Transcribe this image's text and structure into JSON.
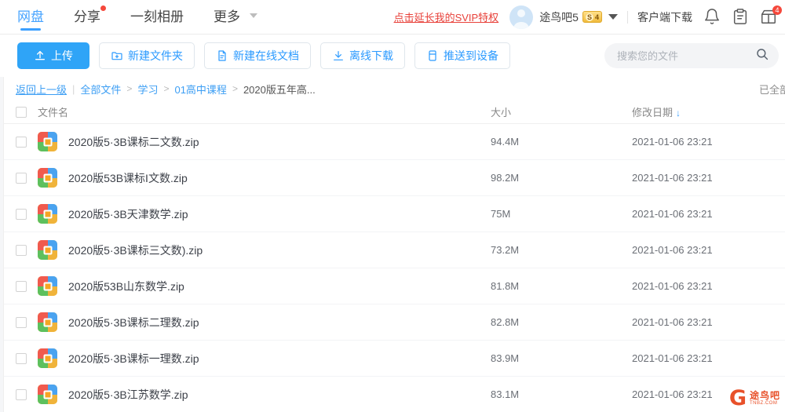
{
  "topnav": {
    "tabs": [
      {
        "label": "网盘",
        "active": true,
        "dot": false
      },
      {
        "label": "分享",
        "active": false,
        "dot": true
      },
      {
        "label": "一刻相册",
        "active": false,
        "dot": false
      },
      {
        "label": "更多",
        "active": false,
        "dot": false,
        "caret": true
      }
    ],
    "svip_link": "点击延长我的SVIP特权",
    "username": "途鸟吧5",
    "vip_badge": {
      "symbol": "S",
      "level": "4"
    },
    "client_download": "客户端下载",
    "icons": [
      {
        "name": "bell-icon",
        "badge": ""
      },
      {
        "name": "clipboard-icon",
        "badge": ""
      },
      {
        "name": "gift-cart-icon",
        "badge": "4"
      }
    ]
  },
  "toolbar": {
    "upload_label": "上传",
    "new_folder_label": "新建文件夹",
    "new_doc_label": "新建在线文档",
    "offline_dl_label": "离线下载",
    "push_device_label": "推送到设备"
  },
  "search": {
    "placeholder": "搜索您的文件",
    "value": ""
  },
  "breadcrumb": {
    "back_label": "返回上一级",
    "separator": "|",
    "items": [
      {
        "label": "全部文件",
        "link": true
      },
      {
        "label": "学习",
        "link": true
      },
      {
        "label": "01高中课程",
        "link": true
      },
      {
        "label": "2020版五年高...",
        "link": false
      }
    ],
    "right_status": "已全部"
  },
  "table": {
    "headers": {
      "name": "文件名",
      "size": "大小",
      "date": "修改日期",
      "sort_arrow": "↓"
    },
    "rows": [
      {
        "name": "2020版5·3B课标二文数.zip",
        "size": "94.4M",
        "date": "2021-01-06 23:21"
      },
      {
        "name": "2020版53B课标I文数.zip",
        "size": "98.2M",
        "date": "2021-01-06 23:21"
      },
      {
        "name": "2020版5·3B天津数学.zip",
        "size": "75M",
        "date": "2021-01-06 23:21"
      },
      {
        "name": "2020版5·3B课标三文数).zip",
        "size": "73.2M",
        "date": "2021-01-06 23:21"
      },
      {
        "name": "2020版53B山东数学.zip",
        "size": "81.8M",
        "date": "2021-01-06 23:21"
      },
      {
        "name": "2020版5·3B课标二理数.zip",
        "size": "82.8M",
        "date": "2021-01-06 23:21"
      },
      {
        "name": "2020版5·3B课标一理数.zip",
        "size": "83.9M",
        "date": "2021-01-06 23:21"
      },
      {
        "name": "2020版5·3B江苏数学.zip",
        "size": "83.1M",
        "date": "2021-01-06 23:21"
      }
    ]
  },
  "watermark": {
    "logo": "G",
    "cn": "途鸟吧",
    "en": "TNBZ.COM"
  },
  "colors": {
    "accent": "#3ca0ff",
    "primary_btn": "#2fa4f7",
    "svip_red": "#e8413a",
    "badge_red": "#f5483b",
    "watermark": "#e8512a"
  }
}
